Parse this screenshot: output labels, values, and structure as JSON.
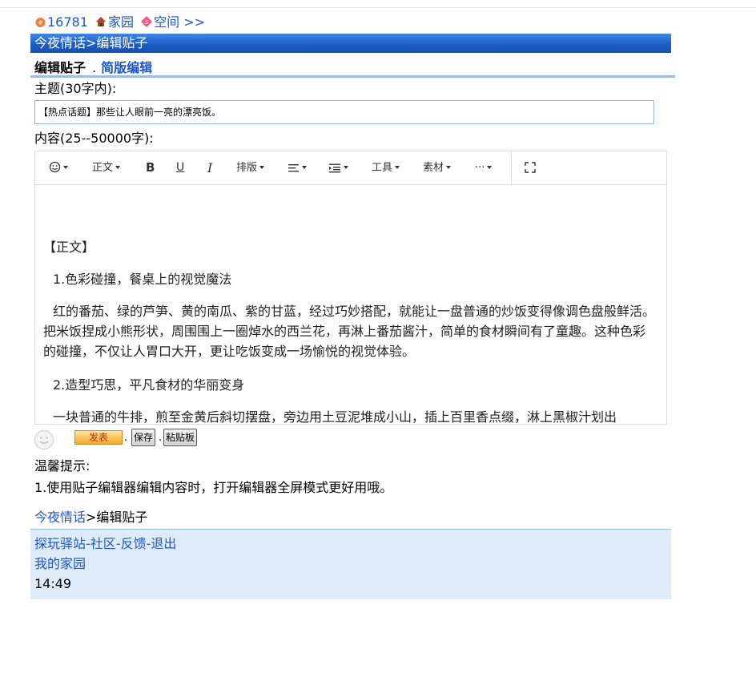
{
  "topnav": {
    "count": "16781",
    "home": "家园",
    "space": "空间 >>"
  },
  "titlebar": {
    "text": "今夜情话>编辑贴子"
  },
  "subhead": {
    "title": "编辑贴子",
    "dot": ".",
    "simple_link": "简版编辑"
  },
  "subject": {
    "label": "主题(30字内):",
    "value": "【热点话题】那些让人眼前一亮的漂亮饭。"
  },
  "content_label": "内容(25--50000字):",
  "toolbar": {
    "emoji": "emoji-icon",
    "text_style": "正文",
    "bold": "B",
    "underline": "U",
    "italic": "I",
    "layout": "排版",
    "align": "align-icon",
    "indent": "indent-icon",
    "tools": "工具",
    "material": "素材",
    "more": "···",
    "fullscreen": "fullscreen-icon"
  },
  "editor_content": [
    "【正文】",
    "1.色彩碰撞，餐桌上的视觉魔法",
    "红的番茄、绿的芦笋、黄的南瓜、紫的甘蓝，经过巧妙搭配，就能让一盘普通的炒饭变得像调色盘般鲜活。把米饭捏成小熊形状，周围围上一圈焯水的西兰花，再淋上番茄酱汁，简单的食材瞬间有了童趣。这种色彩的碰撞，不仅让人胃口大开，更让吃饭变成一场愉悦的视觉体验。",
    "2.造型巧思，平凡食材的华丽变身",
    "一块普通的牛排，煎至金黄后斜切摆盘，旁边用土豆泥堆成小山，插上百里香点缀，淋上黑椒汁划出"
  ],
  "actions": {
    "post": "发表",
    "save": "保存",
    "clipboard": "粘贴板",
    "dot": "."
  },
  "tips": {
    "title": "温馨提示:",
    "line1": "1.使用贴子编辑器编辑内容时，打开编辑器全屏模式更好用哦。"
  },
  "breadcrumb": {
    "link": "今夜情话",
    "rest": ">编辑贴子"
  },
  "footer": {
    "links": [
      "探玩驿站",
      "社区",
      "反馈",
      "退出"
    ],
    "separator": "-",
    "home": "我的家园",
    "time": "14:49"
  },
  "colors": {
    "link": "#1f56c4",
    "titlebar": "#1d5fc5",
    "footer_bg": "#deebfa",
    "post_button": "#f6a92a"
  }
}
